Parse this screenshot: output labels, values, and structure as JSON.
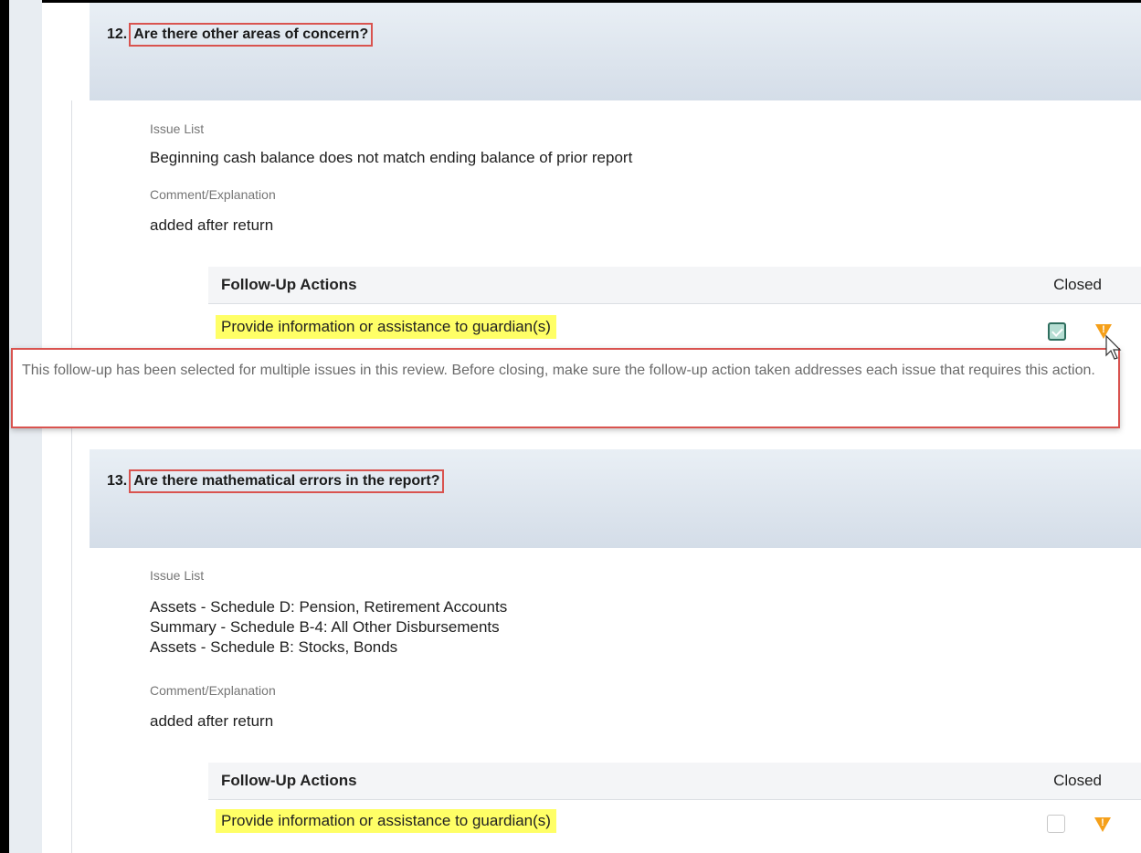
{
  "questions": [
    {
      "number": "12.",
      "title": "Are there other areas of concern?",
      "issue_list_label": "Issue List",
      "issues": [
        "Beginning cash balance does not match ending balance of prior report"
      ],
      "comment_label": "Comment/Explanation",
      "comment": "added after return",
      "followup": {
        "header_actions": "Follow-Up Actions",
        "header_closed": "Closed",
        "rows": [
          {
            "action": "Provide information or assistance to guardian(s)",
            "closed": true
          }
        ]
      }
    },
    {
      "number": "13.",
      "title": "Are there mathematical errors in the report?",
      "issue_list_label": "Issue List",
      "issues": [
        "Assets - Schedule D: Pension, Retirement Accounts",
        "Summary - Schedule B-4: All Other Disbursements",
        "Assets - Schedule B: Stocks, Bonds"
      ],
      "comment_label": "Comment/Explanation",
      "comment": "added after return",
      "followup": {
        "header_actions": "Follow-Up Actions",
        "header_closed": "Closed",
        "rows": [
          {
            "action": "Provide information or assistance to guardian(s)",
            "closed": false
          }
        ]
      }
    }
  ],
  "tooltip": {
    "text": "This follow-up has been selected for multiple issues in this review. Before closing, make sure the follow-up action taken addresses each issue that requires this action."
  },
  "icons": {
    "warning": "warning-icon",
    "cursor": "pointer-cursor-icon"
  },
  "colors": {
    "highlight": "#ffff66",
    "warning": "#f5a01a",
    "annotation_border": "#d9534f",
    "checkbox_checked": "#2e6e5e"
  }
}
